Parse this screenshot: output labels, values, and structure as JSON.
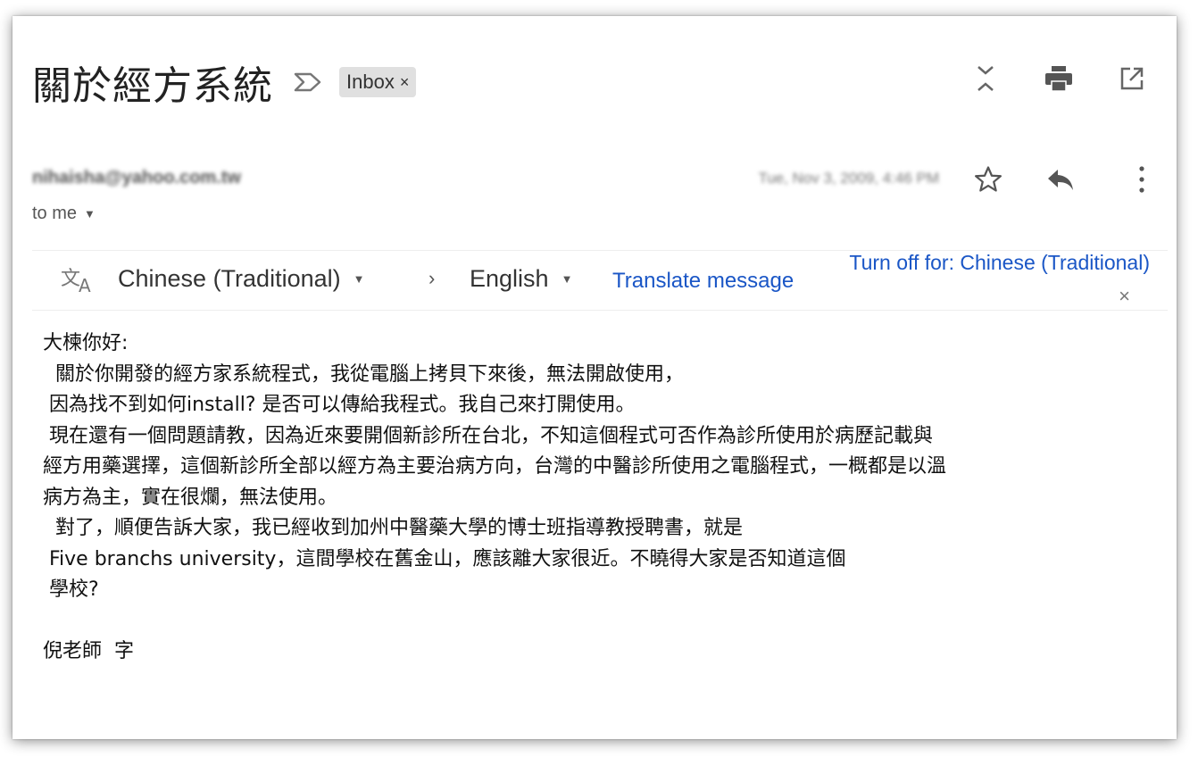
{
  "email": {
    "subject": "關於經方系統",
    "label": "Inbox",
    "label_close": "×",
    "sender": "nihaisha@yahoo.com.tw",
    "date": "Tue, Nov 3, 2009, 4:46 PM",
    "recipient": "to me"
  },
  "translate": {
    "from_lang": "Chinese (Traditional)",
    "to_lang": "English",
    "arrow": "›",
    "translate_link": "Translate message",
    "turn_off": "Turn off for: Chinese (Traditional)",
    "close": "×"
  },
  "body_lines": [
    "大楝你好:",
    "  關於你開發的經方家系統程式，我從電腦上拷貝下來後，無法開啟使用，",
    " 因為找不到如何install? 是否可以傳給我程式。我自己來打開使用。",
    " 現在還有一個問題請教，因為近來要開個新診所在台北，不知這個程式可否作為診所使用於病歷記載與",
    "經方用藥選擇，這個新診所全部以經方為主要治病方向，台灣的中醫診所使用之電腦程式，一概都是以溫",
    "病方為主，實在很爛，無法使用。",
    "  對了，順便告訴大家，我已經收到加州中醫藥大學的博士班指導教授聘書，就是",
    " Five branchs university，這間學校在舊金山，應該離大家很近。不曉得大家是否知道這個",
    " 學校?",
    "",
    "倪老師  字"
  ],
  "icons": {
    "importance": "importance-marker-icon",
    "expand": "expand-collapse-icon",
    "print": "print-icon",
    "popout": "open-in-new-window-icon",
    "star": "star-icon",
    "reply": "reply-icon",
    "more": "more-vert-icon",
    "translate": "translate-icon"
  },
  "colors": {
    "link": "#1a56c6",
    "chip": "#e0e0e0"
  }
}
